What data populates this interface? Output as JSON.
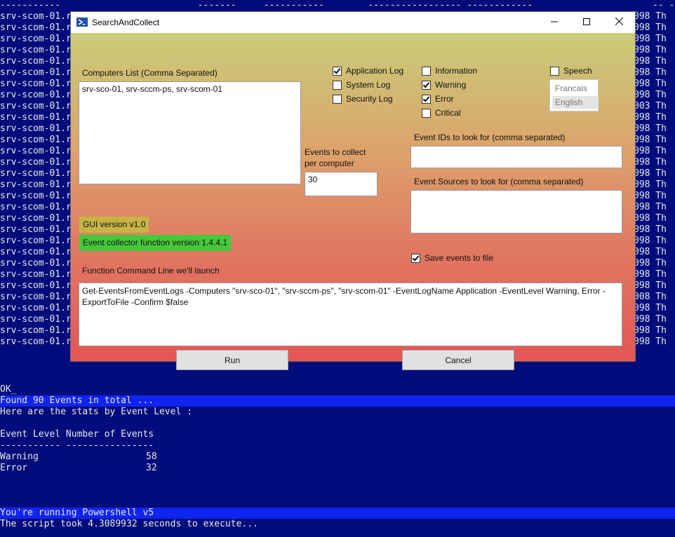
{
  "console": {
    "top_line": "-----------                         -------     -----------        ----------------- ------------",
    "top_line_right": "-- --",
    "bg_lines": [
      {
        "text": "srv-scom-01.r",
        "right": "098 Th"
      },
      {
        "text": "srv-scom-01.r",
        "right": "098 Th"
      },
      {
        "text": "srv-scom-01.r",
        "right": "098 Th"
      },
      {
        "text": "srv-scom-01.r",
        "right": "098 Th"
      },
      {
        "text": "srv-scom-01.r",
        "right": "098 Th"
      },
      {
        "text": "srv-scom-01.r",
        "right": "098 Th"
      },
      {
        "text": "srv-scom-01.r",
        "right": "098 Th"
      },
      {
        "text": "srv-scom-01.r",
        "right": "098 Th"
      },
      {
        "text": "srv-scom-01.r",
        "right": "003 Th"
      },
      {
        "text": "srv-scom-01.r",
        "right": "098 Th"
      },
      {
        "text": "srv-scom-01.r",
        "right": "098 Th"
      },
      {
        "text": "srv-scom-01.r",
        "right": "098 Th"
      },
      {
        "text": "srv-scom-01.r",
        "right": "098 Th"
      },
      {
        "text": "srv-scom-01.r",
        "right": "098 Th"
      },
      {
        "text": "srv-scom-01.r",
        "right": "098 Th"
      },
      {
        "text": "srv-scom-01.r",
        "right": "098 Th"
      },
      {
        "text": "srv-scom-01.r",
        "right": "098 Th"
      },
      {
        "text": "srv-scom-01.r",
        "right": "098 Th"
      },
      {
        "text": "srv-scom-01.r",
        "right": "098 Th"
      },
      {
        "text": "srv-scom-01.r",
        "right": "098 Th"
      },
      {
        "text": "srv-scom-01.r",
        "right": "098 Th"
      },
      {
        "text": "srv-scom-01.r",
        "right": "098 Th"
      },
      {
        "text": "srv-scom-01.r",
        "right": "098 Th"
      },
      {
        "text": "srv-scom-01.r",
        "right": "098 Th"
      },
      {
        "text": "srv-scom-01.r",
        "right": "098 Th"
      },
      {
        "text": "srv-scom-01.r",
        "right": "008 Th"
      },
      {
        "text": "srv-scom-01.r",
        "right": "098 Th"
      },
      {
        "text": "srv-scom-01.r",
        "right": "098 Th"
      },
      {
        "text": "srv-scom-01.r",
        "right": "098 Th"
      },
      {
        "text": "srv-scom-01.r",
        "right": "098 Th"
      }
    ],
    "ok": "OK_",
    "found": "Found 90 Events in total ...",
    "stats_intro": "Here are the stats by Event Level :",
    "table_header": "Event Level Number of Events",
    "table_rule": "----------- ----------------",
    "table_rows": [
      {
        "level": "Warning",
        "count": "58"
      },
      {
        "level": "Error",
        "count": "32"
      }
    ],
    "ps_version": "You're running Powershell v5",
    "duration": "The script took 4.3089932 seconds to execute..."
  },
  "window": {
    "title": "SearchAndCollect",
    "computers_label": "Computers List (Comma Separated)",
    "computers_value": "srv-sco-01, srv-sccm-ps, srv-scom-01",
    "logs": [
      {
        "label": "Application Log",
        "checked": true
      },
      {
        "label": "System Log",
        "checked": false
      },
      {
        "label": "Security Log",
        "checked": false
      }
    ],
    "levels": [
      {
        "label": "Information",
        "checked": false
      },
      {
        "label": "Warning",
        "checked": true
      },
      {
        "label": "Error",
        "checked": true
      },
      {
        "label": "Critical",
        "checked": false
      }
    ],
    "speech": {
      "label": "Speech",
      "checked": false
    },
    "languages": [
      "Francais",
      "English"
    ],
    "selected_language": "English",
    "events_to_collect_label_1": "Events to collect",
    "events_to_collect_label_2": "per computer",
    "events_to_collect_value": "30",
    "event_ids_label": "Event IDs to look for (comma separated)",
    "event_ids_value": "",
    "event_sources_label": "Event Sources to look for (comma separated)",
    "event_sources_value": "",
    "gui_version": "GUI version v1.0",
    "function_version": "Event collector function version 1.4.4.1",
    "save_events": {
      "label": "Save events to file",
      "checked": true
    },
    "command_label": "Function Command Line we'll launch",
    "command_text": "Get-EventsFromEventLogs -Computers \"srv-sco-01\", \"srv-sccm-ps\", \"srv-scom-01\" -EventLogName Application -EventLevel Warning, Error -ExportToFile -Confirm $false",
    "run_label": "Run",
    "cancel_label": "Cancel",
    "colors": {
      "gui_version_bg": "#c8b446",
      "function_version_bg": "#46c83c"
    }
  }
}
